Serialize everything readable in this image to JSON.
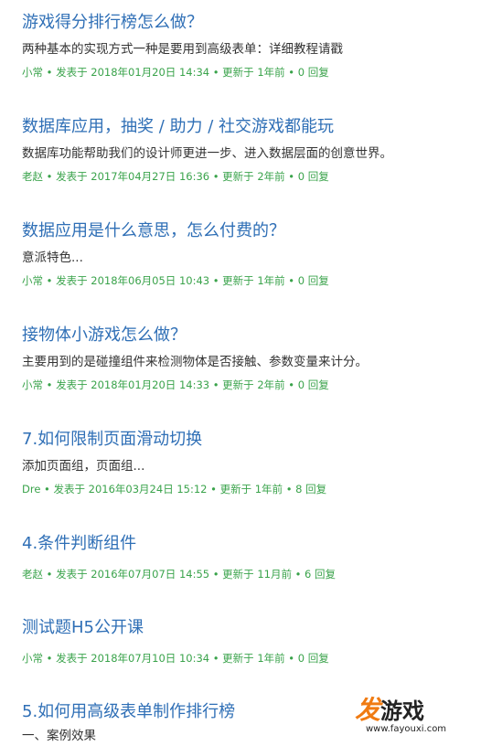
{
  "posts": [
    {
      "title": "游戏得分排行榜怎么做？",
      "excerpt": "两种基本的实现方式一种是要用到高级表单：详细教程请戳",
      "meta": "小常 • 发表于 2018年01月20日 14:34 • 更新于 1年前 • 0 回复"
    },
    {
      "title": "数据库应用，抽奖 / 助力 / 社交游戏都能玩",
      "excerpt": "数据库功能帮助我们的设计师更进一步、进入数据层面的创意世界。",
      "meta": "老赵 • 发表于 2017年04月27日 16:36 • 更新于 2年前 • 0 回复"
    },
    {
      "title": "数据应用是什么意思，怎么付费的？",
      "excerpt": "意派特色...",
      "meta": "小常 • 发表于 2018年06月05日 10:43 • 更新于 1年前 • 0 回复"
    },
    {
      "title": "接物体小游戏怎么做？",
      "excerpt": "主要用到的是碰撞组件来检测物体是否接触、参数变量来计分。",
      "meta": "小常 • 发表于 2018年01月20日 14:33 • 更新于 2年前 • 0 回复"
    },
    {
      "title": "7.如何限制页面滑动切换",
      "excerpt": "添加页面组，页面组...",
      "meta": "Dre • 发表于 2016年03月24日 15:12 • 更新于 1年前 • 8 回复"
    },
    {
      "title": "4.条件判断组件",
      "excerpt": "",
      "meta": "老赵 • 发表于 2016年07月07日 14:55 • 更新于 11月前 • 6 回复"
    },
    {
      "title": "测试题H5公开课",
      "excerpt": "",
      "meta": "小常 • 发表于 2018年07月10日 10:34 • 更新于 1年前 • 0 回复"
    },
    {
      "title": "5.如何用高级表单制作排行榜",
      "excerpt": "一、案例效果",
      "meta": ""
    }
  ],
  "watermark": {
    "logo_mark": "发",
    "logo_text": "游戏",
    "url": "www.fayouxi.com"
  },
  "colors": {
    "title": "#2f6fb6",
    "meta": "#3aa34b",
    "excerpt": "#333333",
    "watermark_accent": "#f07b12"
  }
}
